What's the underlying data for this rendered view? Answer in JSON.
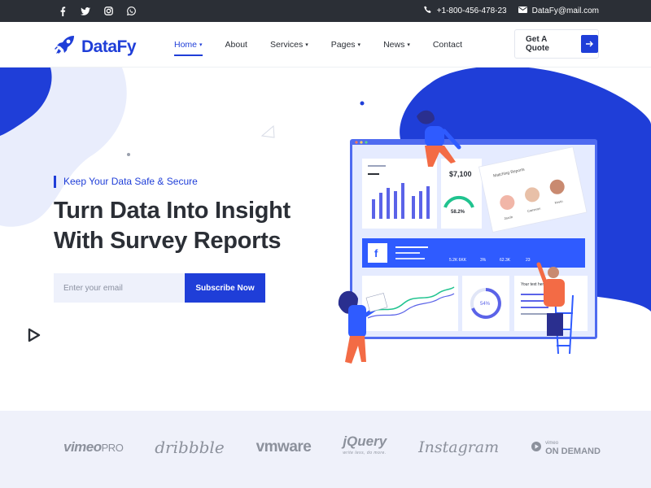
{
  "topbar": {
    "social": [
      "facebook-icon",
      "twitter-icon",
      "instagram-icon",
      "whatsapp-icon"
    ],
    "phone": "+1-800-456-478-23",
    "email": "DataFy@mail.com"
  },
  "header": {
    "brand": "DataFy",
    "nav": [
      {
        "label": "Home",
        "dropdown": true,
        "active": true
      },
      {
        "label": "About",
        "dropdown": false
      },
      {
        "label": "Services",
        "dropdown": true
      },
      {
        "label": "Pages",
        "dropdown": true
      },
      {
        "label": "News",
        "dropdown": true
      },
      {
        "label": "Contact",
        "dropdown": false
      }
    ],
    "cta_label": "Get A Quote"
  },
  "hero": {
    "tagline": "Keep Your Data Safe & Secure",
    "headline_line1": "Turn Data Into Insight",
    "headline_line2": "With Survey Reports",
    "email_placeholder": "Enter your email",
    "subscribe_label": "Subscribe Now"
  },
  "illustration": {
    "card_title": "Earnings",
    "revenue": "$7,100",
    "gauge_value": "58.2%",
    "matching_title": "Matching Reports",
    "profiles": [
      "Jacob",
      "Cameron",
      "Kevin"
    ],
    "stats": [
      "5.2K 6KK",
      "3%",
      "62.3K",
      "23"
    ],
    "donut_value": "54%",
    "text_panel": "Your text here"
  },
  "brands": {
    "vimeo": "vimeo",
    "vimeo_pro": "PRO",
    "dribbble": "dribbble",
    "vmware": "vmware",
    "jquery": "jQuery",
    "jquery_sub": "write less, do more.",
    "instagram": "Instagram",
    "ondemand_small": "vimeo",
    "ondemand": "ON DEMAND"
  },
  "colors": {
    "primary": "#1f3ed8",
    "dark": "#2b2f36",
    "soft": "#e9edfc",
    "orange": "#f36b45"
  }
}
